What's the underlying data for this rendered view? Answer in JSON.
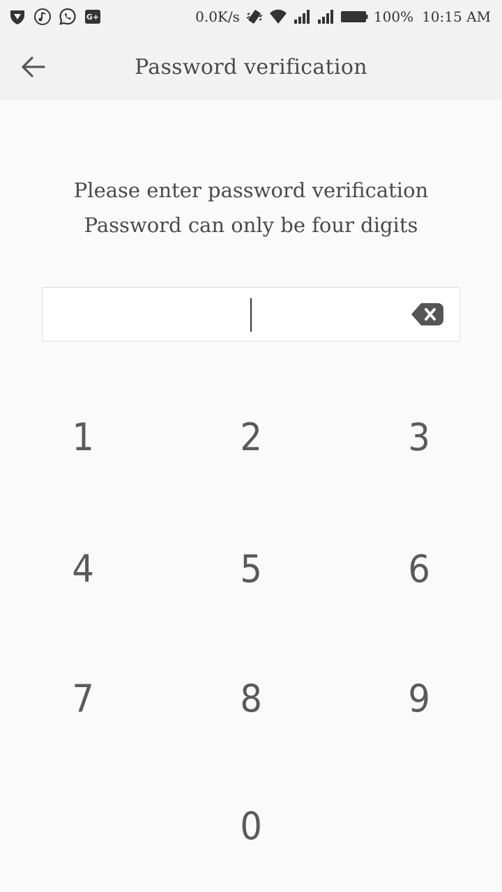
{
  "status_bar": {
    "net_speed": "0.0K/s",
    "battery": "100%",
    "time": "10:15 AM",
    "left_icons": [
      "shield-icon",
      "music-note-icon",
      "whatsapp-icon",
      "google-plus-icon"
    ],
    "right_icons": [
      "vibrate-icon",
      "wifi-icon",
      "signal-icon",
      "signal-icon",
      "battery-icon"
    ]
  },
  "header": {
    "title": "Password verification",
    "back_icon": "arrow-left-icon"
  },
  "instructions": {
    "line1": "Please enter password verification",
    "line2": "Password can only be four digits"
  },
  "pin_input": {
    "value": "",
    "clear_icon": "backspace-icon"
  },
  "keypad": {
    "keys": [
      "1",
      "2",
      "3",
      "4",
      "5",
      "6",
      "7",
      "8",
      "9",
      "0"
    ]
  },
  "colors": {
    "background": "#fafafa",
    "bar_background": "#f2f2f2",
    "text": "#4a4a4a"
  }
}
